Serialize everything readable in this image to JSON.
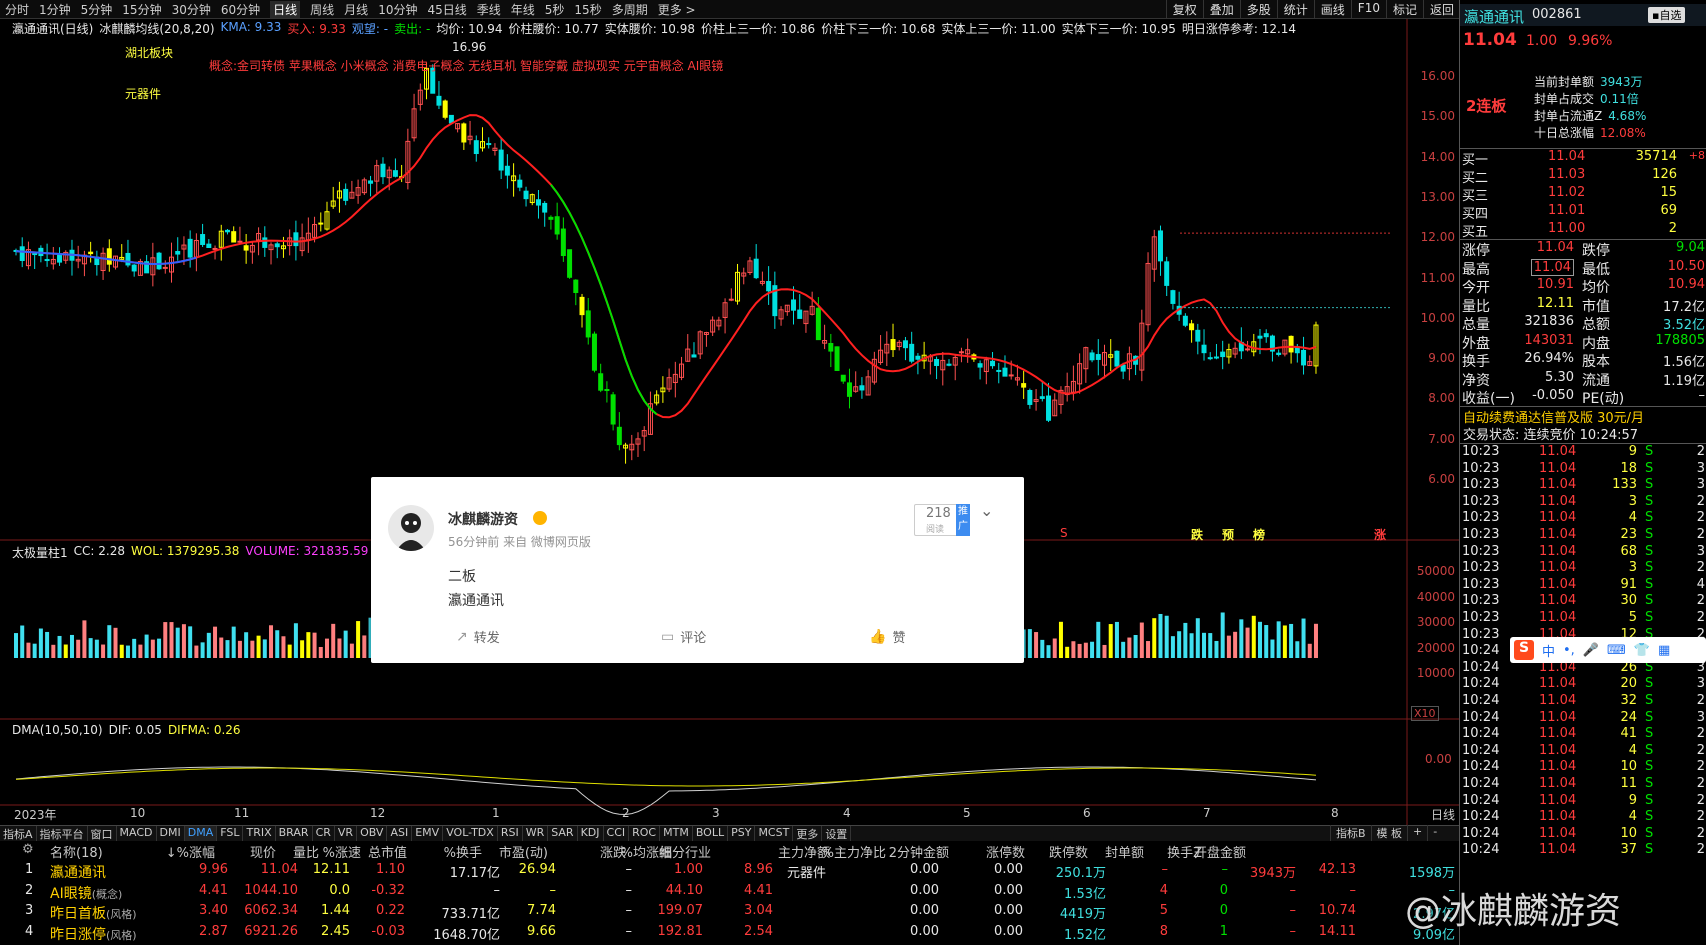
{
  "top_tabs": [
    "分时",
    "1分钟",
    "5分钟",
    "15分钟",
    "30分钟",
    "60分钟",
    "日线",
    "周线",
    "月线",
    "10分钟",
    "45日线",
    "季线",
    "年线",
    "5秒",
    "15秒",
    "多周期",
    "更多 >"
  ],
  "active_tab": "日线",
  "top_right_buttons": [
    "复权",
    "叠加",
    "多股",
    "统计",
    "画线",
    "F10",
    "标记",
    "返回"
  ],
  "stock_name_title": "瀛通通讯(日线)",
  "indicator_line": {
    "name": "冰麒麟均线(20,8,20)",
    "kma_label": "KMA: 9.33",
    "buy_label": "买入: 9.33",
    "watch_label": "观望: -",
    "sell_label": "卖出: -",
    "avg_price": "均价: 10.94",
    "stem_mid": "价柱腰价: 10.77",
    "body_mid": "实体腰价: 10.98",
    "stem_up_third": "价柱上三一价: 10.86",
    "stem_down_third": "价柱下三一价: 10.68",
    "body_up_third": "实体上三一价: 11.00",
    "body_down_third": "实体下三一价: 10.95",
    "next_limit": "明日涨停参考: 12.14"
  },
  "chart_labels": {
    "sector": "湖北板块",
    "concept_sector": "元器件",
    "concepts": "概念:金司转债 苹果概念 小米概念 消费电子概念 无线耳机 智能穿戴 虚拟现实 元宇宙概念 AI眼镜",
    "high_mark": "16.96",
    "signal_marks": [
      "跌",
      "预",
      "榜",
      "涨"
    ],
    "s_mark": "S"
  },
  "price_axis": [
    "16.00",
    "15.00",
    "14.00",
    "13.00",
    "12.00",
    "11.00",
    "10.00",
    "9.00",
    "8.00",
    "7.00",
    "6.00"
  ],
  "volume_line": {
    "name": "太极量柱1",
    "cc": "CC: 2.28",
    "wol": "WOL: 1379295.38",
    "volume": "VOLUME: 321835.59"
  },
  "volume_axis": [
    "50000",
    "40000",
    "30000",
    "20000",
    "10000"
  ],
  "volume_unit": "X10",
  "dma_line": {
    "name": "DMA(10,50,10)",
    "dif": "DIF: 0.05",
    "difma": "DIFMA: 0.26"
  },
  "dma_axis": "0.00",
  "x_axis": [
    "2023年",
    "10",
    "11",
    "12",
    "1",
    "2",
    "3",
    "4",
    "5",
    "6",
    "7",
    "8",
    "日线"
  ],
  "bottom_tabs": [
    "指标A",
    "指标平台",
    "窗口",
    "MACD",
    "DMI",
    "DMA",
    "FSL",
    "TRIX",
    "BRAR",
    "CR",
    "VR",
    "OBV",
    "ASI",
    "EMV",
    "VOL-TDX",
    "RSI",
    "WR",
    "SAR",
    "KDJ",
    "CCI",
    "ROC",
    "MTM",
    "BOLL",
    "PSY",
    "MCST",
    "更多",
    "设置"
  ],
  "active_bottom_tab": "DMA",
  "bottom_right_tabs": [
    "指标B",
    "模 板",
    "+",
    "-"
  ],
  "table": {
    "headers": [
      "名称(18)",
      "涨幅%↓",
      "现价",
      "量比",
      "涨速%",
      "总市值",
      "换手%",
      "市盈(动)",
      "涨跌",
      "均涨幅%",
      "细分行业",
      "主力净额",
      "主力净比%",
      "2分钟金额",
      "涨停数",
      "跌停数",
      "封单额",
      "换手Z",
      "开盘金额"
    ],
    "rows": [
      {
        "idx": "1",
        "name": "瀛通通讯",
        "tag": "",
        "pct": "9.96",
        "price": "11.04",
        "vr": "12.11",
        "speed": "1.10",
        "mcap": "17.17亿",
        "turn": "26.94",
        "pe": "–",
        "chg": "1.00",
        "avg": "8.96",
        "ind": "元器件",
        "net": "0.00",
        "netr": "0.00",
        "amt2": "250.1万",
        "up": "–",
        "down": "–",
        "seal": "3943万",
        "tz": "42.13",
        "open": "1598万"
      },
      {
        "idx": "2",
        "name": "AI眼镜",
        "tag": "(概念)",
        "pct": "4.41",
        "price": "1044.10",
        "vr": "0.0",
        "speed": "-0.32",
        "mcap": "–",
        "turn": "–",
        "pe": "–",
        "chg": "44.10",
        "avg": "4.41",
        "ind": "",
        "net": "0.00",
        "netr": "0.00",
        "amt2": "1.53亿",
        "up": "4",
        "down": "0",
        "seal": "–",
        "tz": "–",
        "open": "–"
      },
      {
        "idx": "3",
        "name": "昨日首板",
        "tag": "(风格)",
        "pct": "3.40",
        "price": "6062.34",
        "vr": "1.44",
        "speed": "0.22",
        "mcap": "733.71亿",
        "turn": "7.74",
        "pe": "–",
        "chg": "199.07",
        "avg": "3.04",
        "ind": "",
        "net": "0.00",
        "netr": "0.00",
        "amt2": "4419万",
        "up": "5",
        "down": "0",
        "seal": "–",
        "tz": "10.74",
        "open": "2.97亿"
      },
      {
        "idx": "4",
        "name": "昨日涨停",
        "tag": "(风格)",
        "pct": "2.87",
        "price": "6921.26",
        "vr": "2.45",
        "speed": "-0.03",
        "mcap": "1648.70亿",
        "turn": "9.66",
        "pe": "–",
        "chg": "192.81",
        "avg": "2.54",
        "ind": "",
        "net": "0.00",
        "netr": "0.00",
        "amt2": "1.52亿",
        "up": "8",
        "down": "1",
        "seal": "–",
        "tz": "14.11",
        "open": "9.09亿"
      }
    ]
  },
  "right_panel": {
    "name": "瀛通通讯",
    "code": "002861",
    "mode_btn": "▪自选",
    "price": "11.04",
    "chg": "1.00",
    "pct": "9.96%",
    "board": "2连板",
    "seal_stats": [
      {
        "label": "当前封单额",
        "value": "3943万"
      },
      {
        "label": "封单占成交",
        "value": "0.11倍"
      },
      {
        "label": "封单占流通Z",
        "value": "4.68%"
      },
      {
        "label": "十日总涨幅",
        "value": "12.08%"
      }
    ],
    "bids": [
      {
        "label": "买一",
        "price": "11.04",
        "vol": "35714",
        "delta": "+8"
      },
      {
        "label": "买二",
        "price": "11.03",
        "vol": "126",
        "delta": ""
      },
      {
        "label": "买三",
        "price": "11.02",
        "vol": "15",
        "delta": ""
      },
      {
        "label": "买四",
        "price": "11.01",
        "vol": "69",
        "delta": ""
      },
      {
        "label": "买五",
        "price": "11.00",
        "vol": "2",
        "delta": ""
      }
    ],
    "stats": [
      {
        "l1": "涨停",
        "v1": "11.04",
        "l2": "跌停",
        "v2": "9.04"
      },
      {
        "l1": "最高",
        "v1": "11.04",
        "l2": "最低",
        "v2": "10.50"
      },
      {
        "l1": "今开",
        "v1": "10.91",
        "l2": "均价",
        "v2": "10.94"
      },
      {
        "l1": "量比",
        "v1": "12.11",
        "l2": "市值",
        "v2": "17.2亿"
      },
      {
        "l1": "总量",
        "v1": "321836",
        "l2": "总额",
        "v2": "3.52亿"
      },
      {
        "l1": "外盘",
        "v1": "143031",
        "l2": "内盘",
        "v2": "178805"
      },
      {
        "l1": "换手",
        "v1": "26.94%",
        "l2": "股本",
        "v2": "1.56亿"
      },
      {
        "l1": "净资",
        "v1": "5.30",
        "l2": "流通",
        "v2": "1.19亿"
      },
      {
        "l1": "收益(一)",
        "v1": "-0.050",
        "l2": "PE(动)",
        "v2": "–"
      }
    ],
    "promo": "自动续费通达信普及版  30元/月",
    "trade_status": "交易状态: 连续竞价 10:24:57",
    "ticks": [
      {
        "t": "10:23",
        "p": "11.04",
        "v": "9",
        "s": "S",
        "n": "2"
      },
      {
        "t": "10:23",
        "p": "11.04",
        "v": "18",
        "s": "S",
        "n": "3"
      },
      {
        "t": "10:23",
        "p": "11.04",
        "v": "133",
        "s": "S",
        "n": "3"
      },
      {
        "t": "10:23",
        "p": "11.04",
        "v": "3",
        "s": "S",
        "n": "2"
      },
      {
        "t": "10:23",
        "p": "11.04",
        "v": "4",
        "s": "S",
        "n": "2"
      },
      {
        "t": "10:23",
        "p": "11.04",
        "v": "23",
        "s": "S",
        "n": "2"
      },
      {
        "t": "10:23",
        "p": "11.04",
        "v": "68",
        "s": "S",
        "n": "3"
      },
      {
        "t": "10:23",
        "p": "11.04",
        "v": "3",
        "s": "S",
        "n": "2"
      },
      {
        "t": "10:23",
        "p": "11.04",
        "v": "91",
        "s": "S",
        "n": "4"
      },
      {
        "t": "10:23",
        "p": "11.04",
        "v": "30",
        "s": "S",
        "n": "2"
      },
      {
        "t": "10:23",
        "p": "11.04",
        "v": "5",
        "s": "S",
        "n": "2"
      },
      {
        "t": "10:23",
        "p": "11.04",
        "v": "12",
        "s": "S",
        "n": "2"
      },
      {
        "t": "10:24",
        "p": "11.04",
        "v": "48",
        "s": "S",
        "n": "3"
      },
      {
        "t": "10:24",
        "p": "11.04",
        "v": "26",
        "s": "S",
        "n": "3"
      },
      {
        "t": "10:24",
        "p": "11.04",
        "v": "20",
        "s": "S",
        "n": "3"
      },
      {
        "t": "10:24",
        "p": "11.04",
        "v": "32",
        "s": "S",
        "n": "2"
      },
      {
        "t": "10:24",
        "p": "11.04",
        "v": "24",
        "s": "S",
        "n": "3"
      },
      {
        "t": "10:24",
        "p": "11.04",
        "v": "41",
        "s": "S",
        "n": "2"
      },
      {
        "t": "10:24",
        "p": "11.04",
        "v": "4",
        "s": "S",
        "n": "2"
      },
      {
        "t": "10:24",
        "p": "11.04",
        "v": "10",
        "s": "S",
        "n": "2"
      },
      {
        "t": "10:24",
        "p": "11.04",
        "v": "11",
        "s": "S",
        "n": "2"
      },
      {
        "t": "10:24",
        "p": "11.04",
        "v": "9",
        "s": "S",
        "n": "2"
      },
      {
        "t": "10:24",
        "p": "11.04",
        "v": "4",
        "s": "S",
        "n": "2"
      },
      {
        "t": "10:24",
        "p": "11.04",
        "v": "10",
        "s": "S",
        "n": "2"
      },
      {
        "t": "10:24",
        "p": "11.04",
        "v": "37",
        "s": "S",
        "n": "2"
      }
    ]
  },
  "popup": {
    "author": "冰麒麟游资",
    "meta": "56分钟前 来自 微博网页版",
    "views": "218",
    "views_label": "阅读",
    "promote": "推广",
    "line1": "二板",
    "line2": "瀛通通讯",
    "repost": "转发",
    "comment": "评论",
    "like": "赞"
  },
  "ime": {
    "brand": "S",
    "lang": "中"
  },
  "watermark": "@冰麒麟游资",
  "colors": {
    "up": "#ff3c3c",
    "down": "#00e000",
    "bg": "#000000",
    "accent": "#ffff40"
  }
}
